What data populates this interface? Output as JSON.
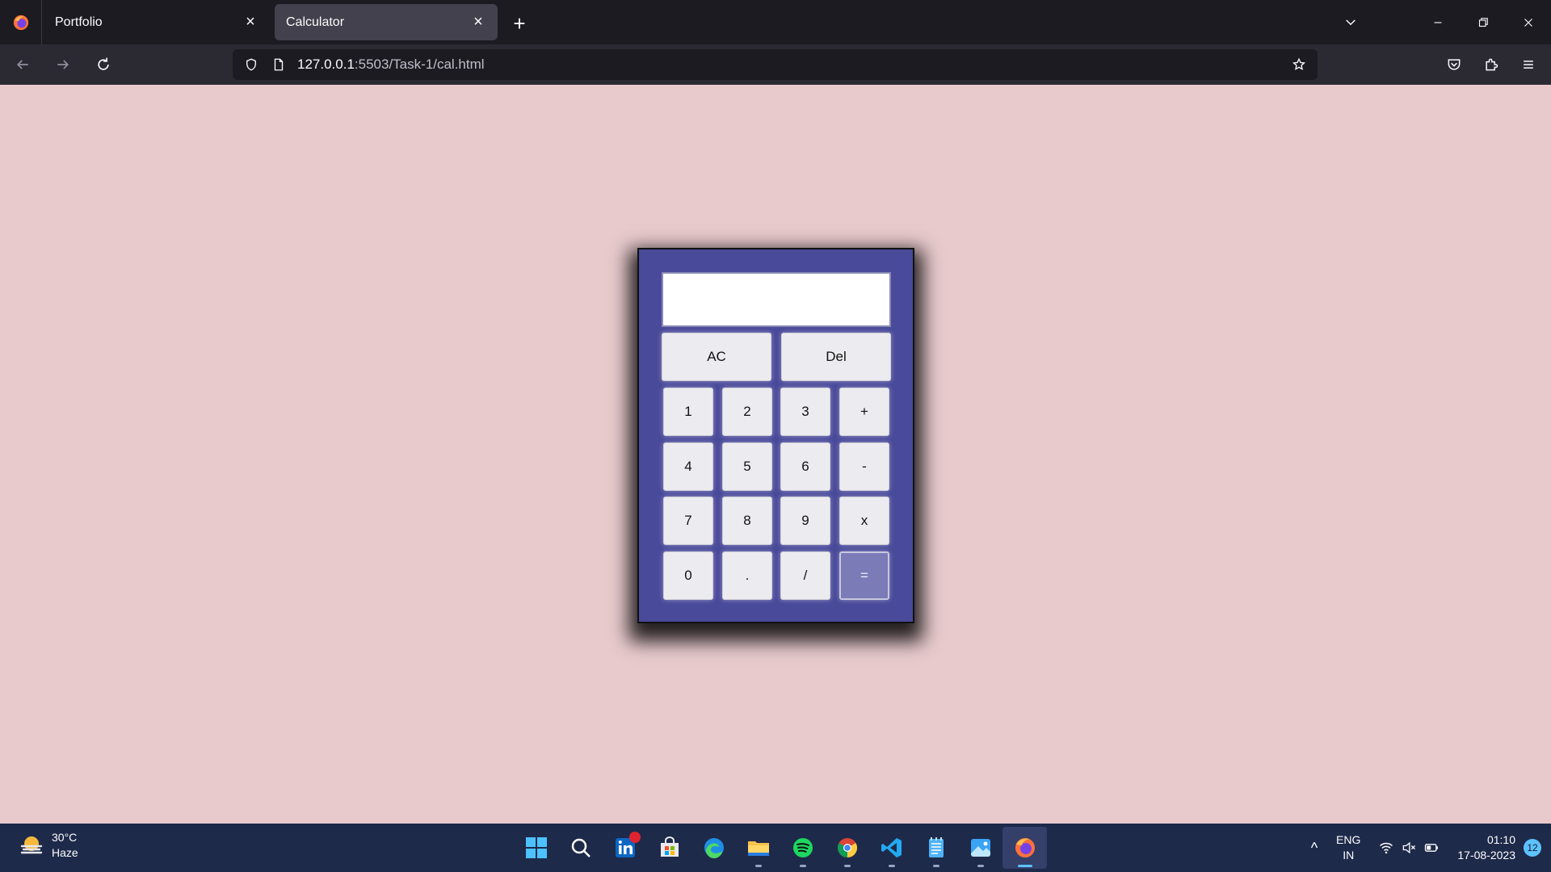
{
  "browser": {
    "tabs": [
      {
        "label": "Portfolio",
        "active": false
      },
      {
        "label": "Calculator",
        "active": true
      }
    ],
    "new_tab_label": "+",
    "url_host": "127.0.0.1",
    "url_path": ":5503/Task-1/cal.html"
  },
  "calculator": {
    "display_value": "",
    "buttons": {
      "ac": "AC",
      "del": "Del",
      "b1": "1",
      "b2": "2",
      "b3": "3",
      "plus": "+",
      "b4": "4",
      "b5": "5",
      "b6": "6",
      "minus": "-",
      "b7": "7",
      "b8": "8",
      "b9": "9",
      "times": "x",
      "b0": "0",
      "dot": ".",
      "divide": "/",
      "equals": "="
    },
    "colors": {
      "body": "#4a4a9a",
      "page_bg": "#e8cacd",
      "equals_bg": "#7b7bb8"
    }
  },
  "taskbar": {
    "weather_temp": "30°C",
    "weather_desc": "Haze",
    "lang_line1": "ENG",
    "lang_line2": "IN",
    "time": "01:10",
    "date": "17-08-2023",
    "notification_count": "12",
    "apps": [
      "start-icon",
      "search-icon",
      "linkedin-icon",
      "store-icon",
      "edge-icon",
      "file-explorer-icon",
      "spotify-icon",
      "chrome-icon",
      "vscode-icon",
      "notepad-icon",
      "photos-icon",
      "firefox-icon"
    ]
  }
}
